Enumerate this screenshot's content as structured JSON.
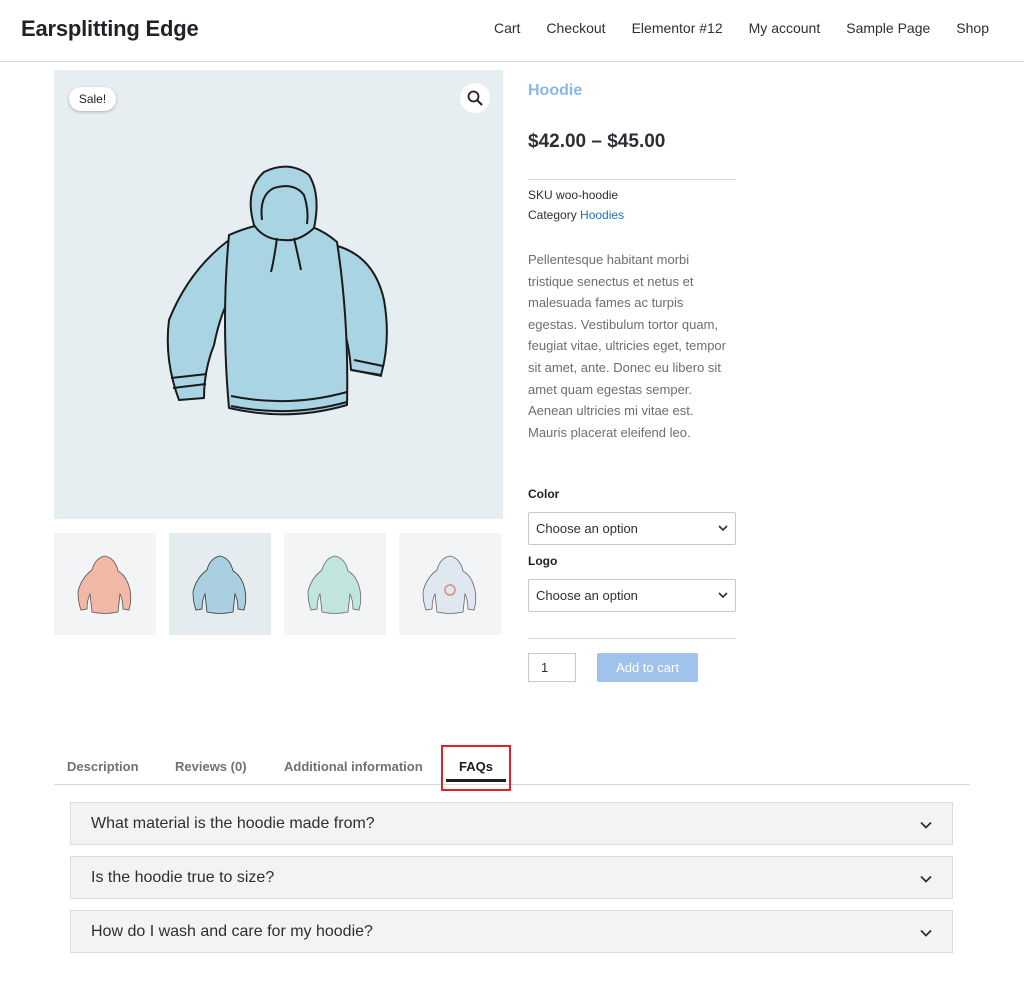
{
  "header": {
    "site_title": "Earsplitting Edge",
    "nav": [
      "Cart",
      "Checkout",
      "Elementor #12",
      "My account",
      "Sample Page",
      "Shop"
    ]
  },
  "gallery": {
    "sale_badge": "Sale!",
    "main_color": "#a9d4e3",
    "thumbnails": [
      {
        "color": "#f2b8a6",
        "active": false
      },
      {
        "color": "#a9cfe0",
        "active": true
      },
      {
        "color": "#bfe5dd",
        "active": false
      },
      {
        "color": "#dfe8f0",
        "active": false
      }
    ]
  },
  "product": {
    "title": "Hoodie",
    "price": "$42.00 – $45.00",
    "sku_label": "SKU",
    "sku": "woo-hoodie",
    "category_label": "Category",
    "category": "Hoodies",
    "description": "Pellentesque habitant morbi tristique senectus et netus et malesuada fames ac turpis egestas. Vestibulum tortor quam, feugiat vitae, ultricies eget, tempor sit amet, ante. Donec eu libero sit amet quam egestas semper. Aenean ultricies mi vitae est. Mauris placerat eleifend leo.",
    "color_label": "Color",
    "color_placeholder": "Choose an option",
    "logo_label": "Logo",
    "logo_placeholder": "Choose an option",
    "quantity": "1",
    "add_to_cart": "Add to cart"
  },
  "tabs": [
    {
      "label": "Description",
      "active": false
    },
    {
      "label": "Reviews (0)",
      "active": false
    },
    {
      "label": "Additional information",
      "active": false
    },
    {
      "label": "FAQs",
      "active": true
    }
  ],
  "faqs": [
    "What material is the hoodie made from?",
    "Is the hoodie true to size?",
    "How do I wash and care for my hoodie?"
  ],
  "colors": {
    "accent": "#8bb7e3",
    "link": "#1f72c0",
    "button": "#9fc3ea",
    "highlight": "#e0222c"
  }
}
